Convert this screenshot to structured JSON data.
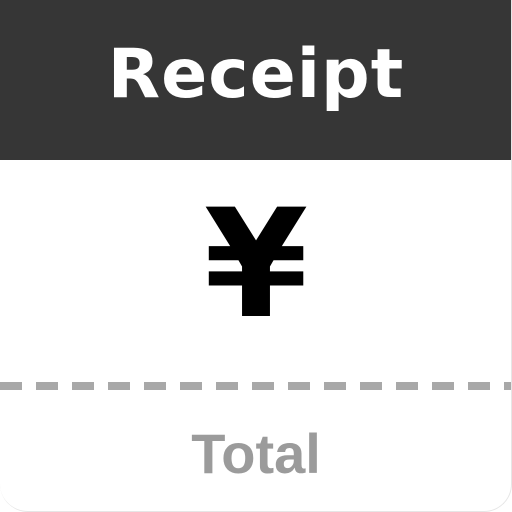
{
  "header": {
    "title": "Receipt",
    "background": "#363636"
  },
  "amount": {
    "currency_symbol": "¥"
  },
  "footer": {
    "label": "Total",
    "label_color": "#9b9b9b"
  },
  "divider": {
    "color": "#a8a8a8",
    "style": "dashed"
  }
}
